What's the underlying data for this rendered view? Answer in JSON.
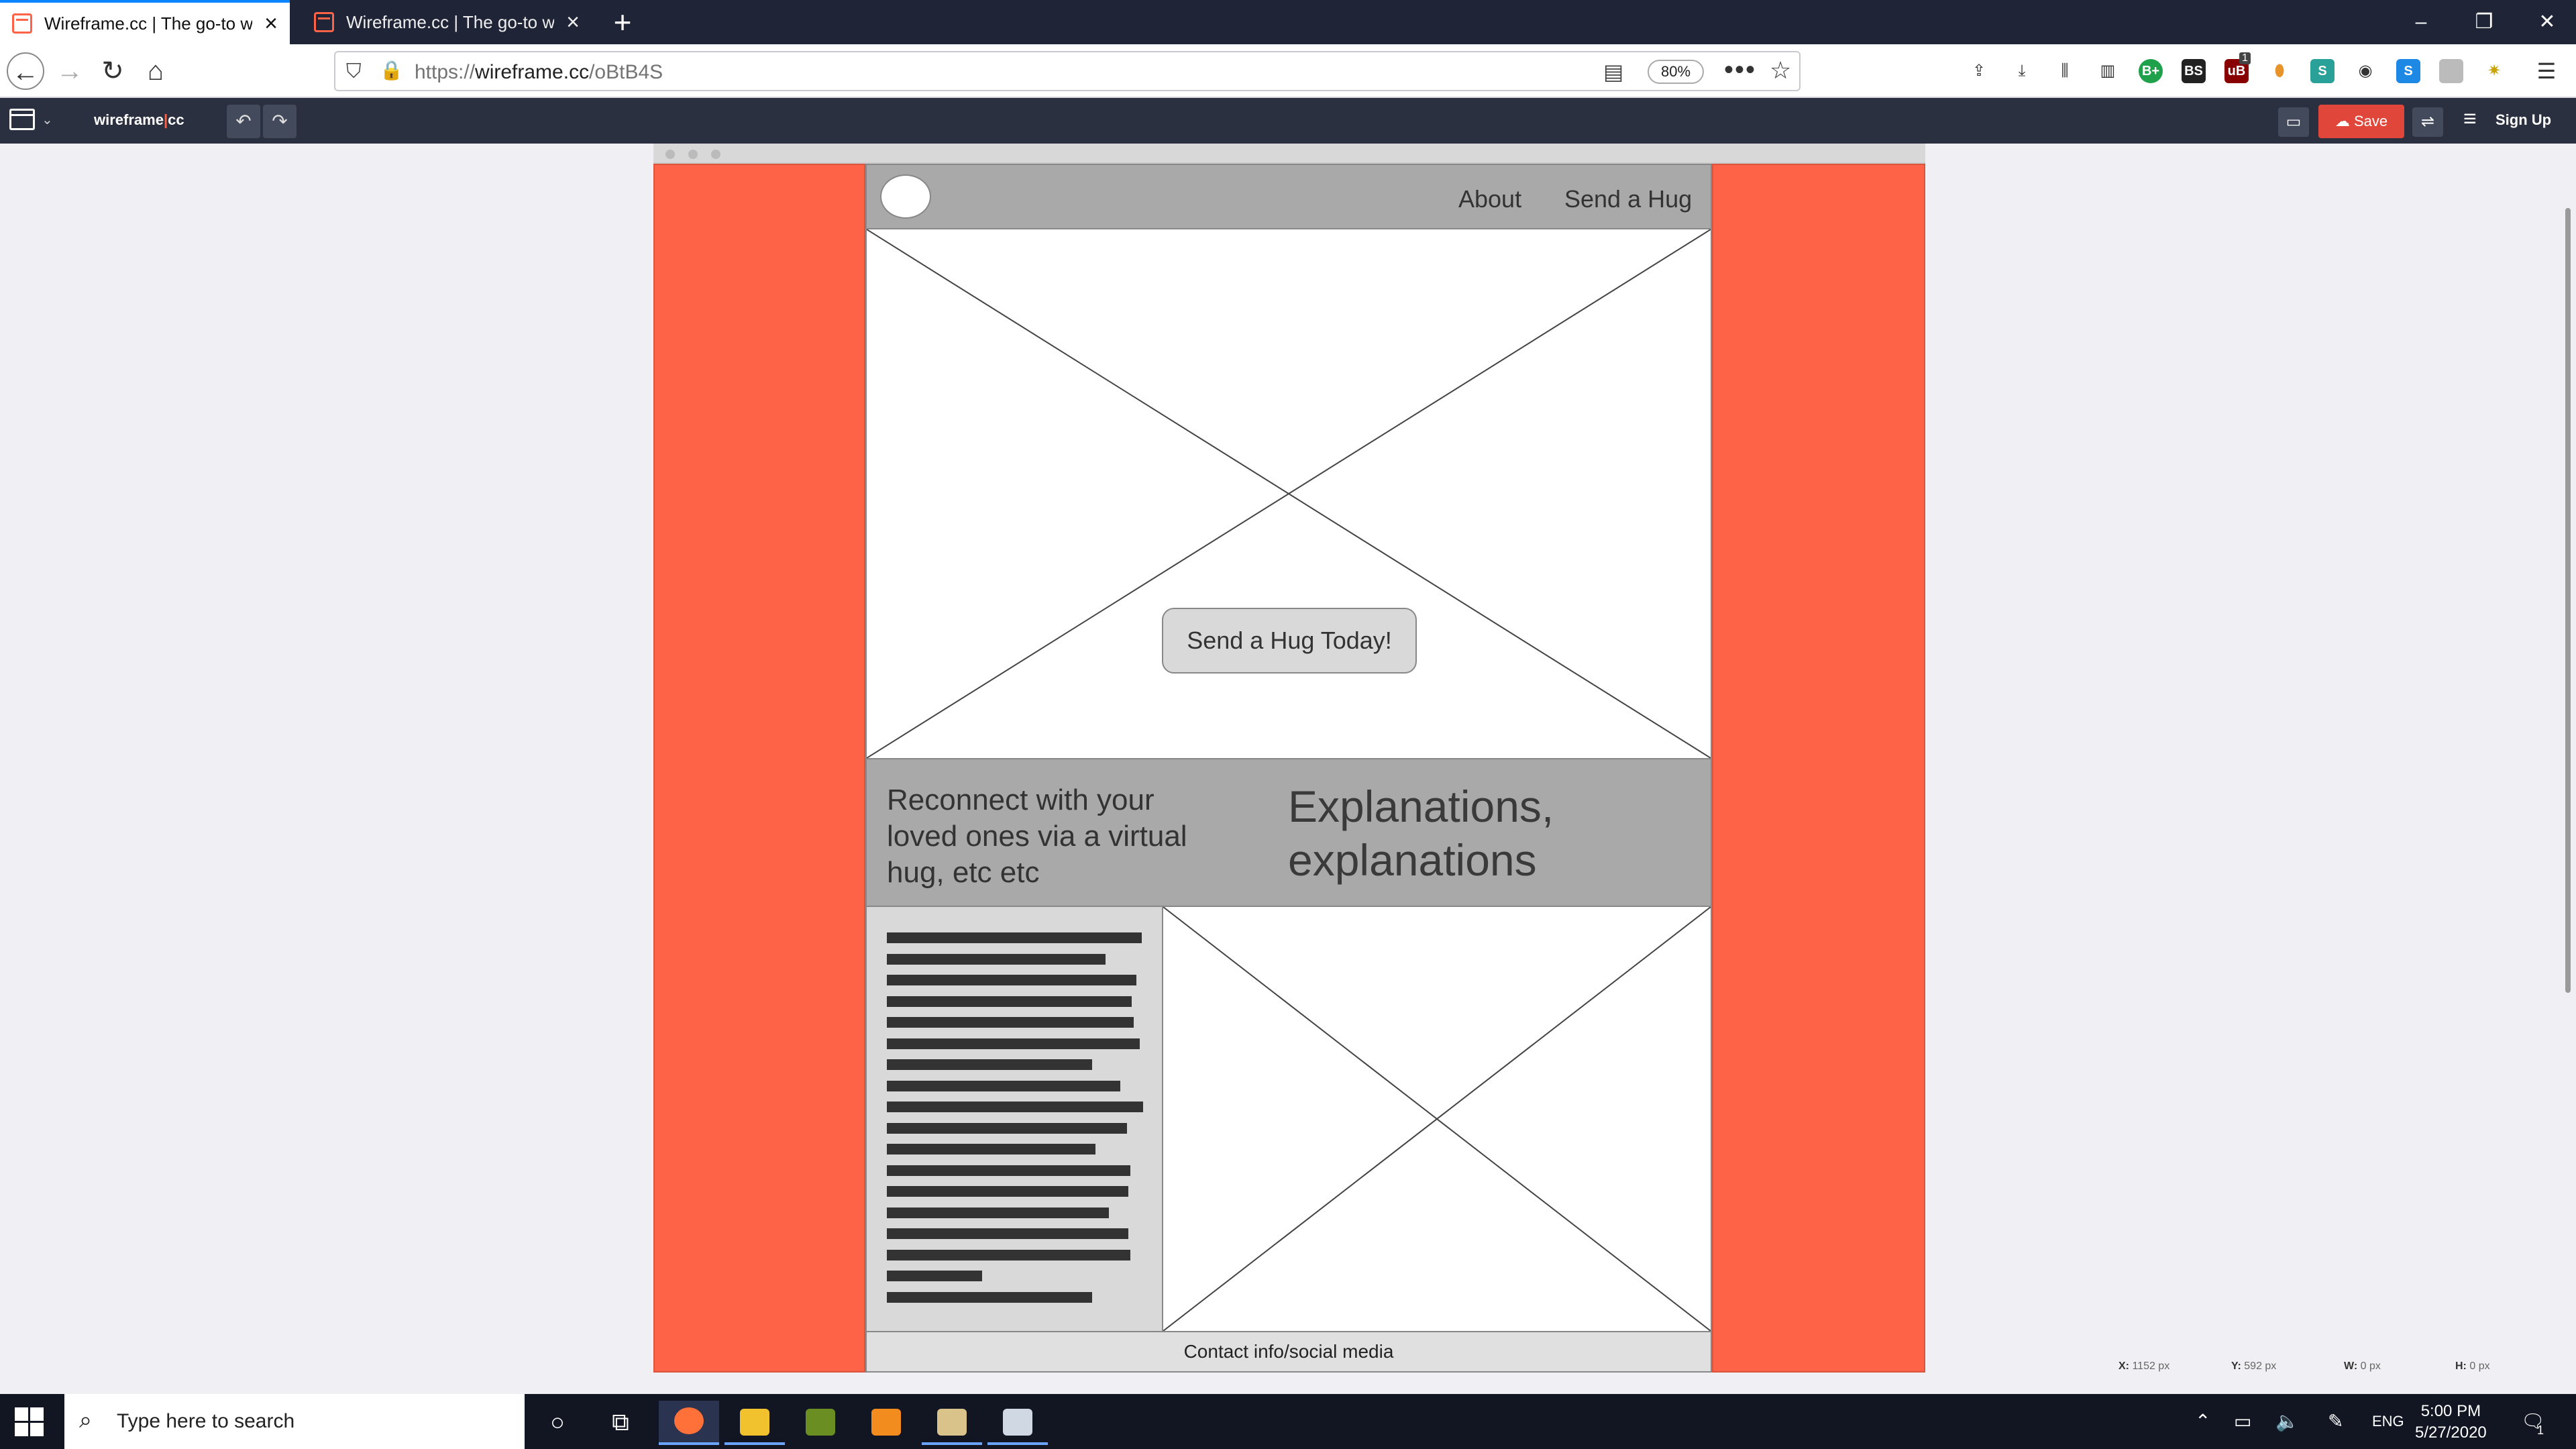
{
  "browser": {
    "tabs": [
      {
        "title": "Wireframe.cc | The go-to wiref",
        "active": true
      },
      {
        "title": "Wireframe.cc | The go-to wiref",
        "active": false
      }
    ],
    "new_tab": "+",
    "window_controls": {
      "minimize": "–",
      "restore": "❐",
      "close": "✕"
    },
    "url_prefix": "https://",
    "url_host": "wireframe.cc",
    "url_path": "/oBtB4S",
    "zoom": "80%",
    "page_actions": "•••",
    "badge_count": "1",
    "ext_labels": {
      "bplus": "B+",
      "bs": "BS",
      "ublock": "uB",
      "s": "S"
    }
  },
  "app": {
    "logo_left": "wireframe",
    "logo_sep": "|",
    "logo_right": "cc",
    "save_label": "Save",
    "signup_label": "Sign Up",
    "undo": "↶",
    "redo": "↷"
  },
  "wireframe": {
    "nav": [
      "About",
      "Send a Hug"
    ],
    "hero_button": "Send a Hug Today!",
    "tagline": "Reconnect with your loved ones  via a virtual hug, etc etc",
    "explanation": "Explanations, explanations",
    "text_lines": [
      155,
      133,
      152,
      149,
      150,
      154,
      125,
      142,
      156,
      146,
      127,
      148,
      147,
      135,
      147,
      148,
      58,
      125
    ],
    "footer": "Contact info/social media"
  },
  "status": {
    "x_label": "X:",
    "x_value": "1152 px",
    "y_label": "Y:",
    "y_value": "592 px",
    "w_label": "W:",
    "w_value": "0 px",
    "h_label": "H:",
    "h_value": "0 px"
  },
  "taskbar": {
    "search_placeholder": "Type here to search",
    "language": "ENG",
    "time": "5:00 PM",
    "date": "5/27/2020",
    "notifications": "1"
  },
  "colors": {
    "accent_orange": "#ff6347",
    "save_red": "#e0473a",
    "toolbar_dark": "#2b3040",
    "titlebar_dark": "#1f2436"
  }
}
